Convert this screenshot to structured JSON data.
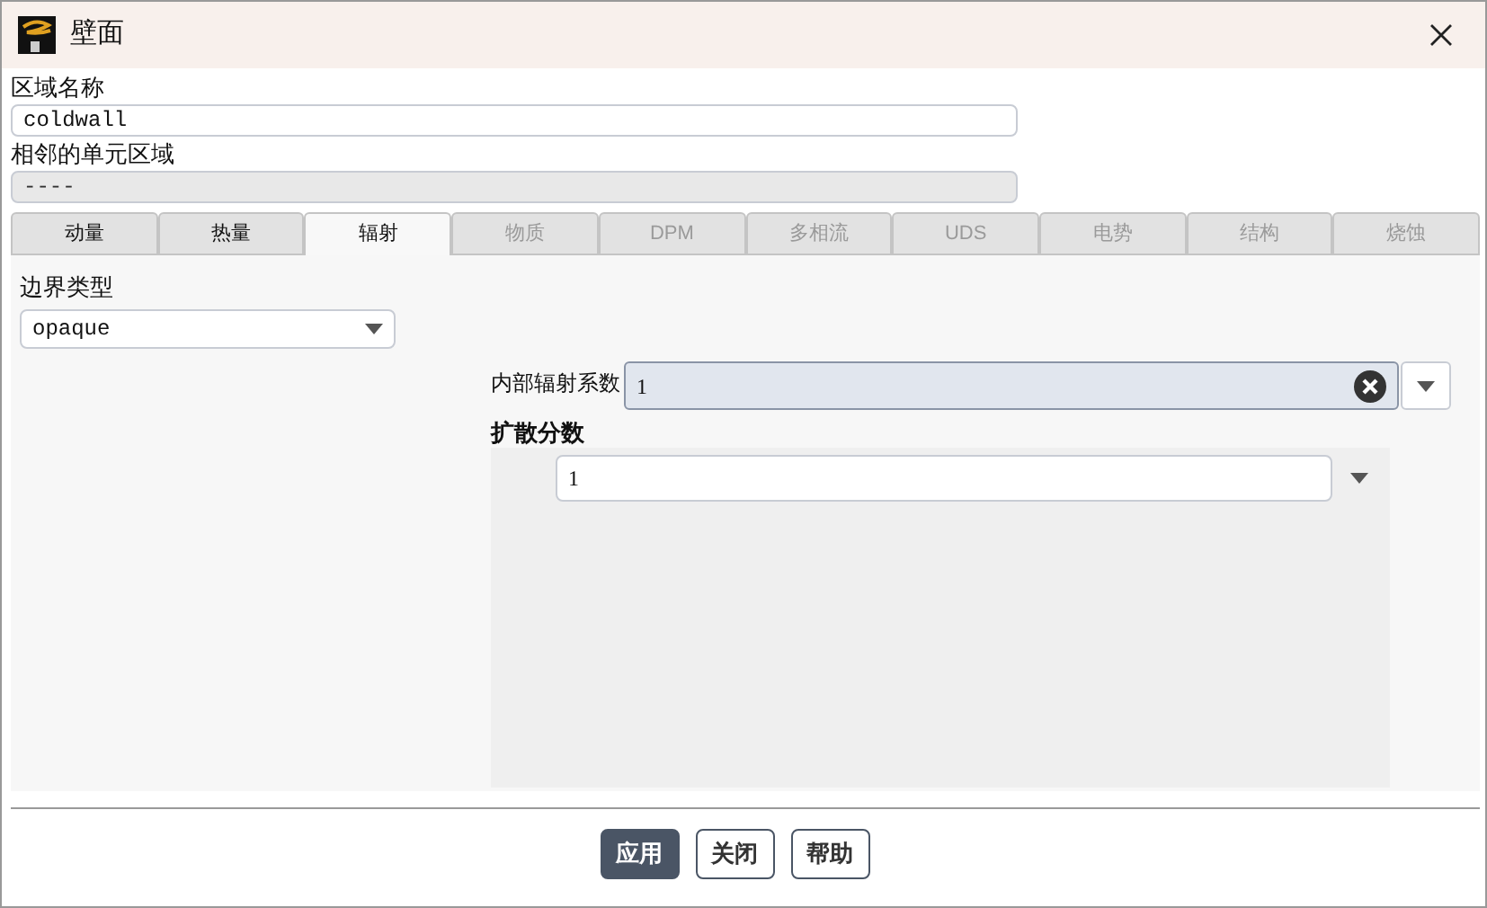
{
  "window": {
    "title": "壁面"
  },
  "zone_name": {
    "label": "区域名称",
    "value": "coldwall"
  },
  "adjacent_zone": {
    "label": "相邻的单元区域",
    "value": "----"
  },
  "tabs": [
    {
      "label": "动量",
      "selected": false,
      "disabled": false
    },
    {
      "label": "热量",
      "selected": false,
      "disabled": false
    },
    {
      "label": "辐射",
      "selected": true,
      "disabled": false
    },
    {
      "label": "物质",
      "selected": false,
      "disabled": true
    },
    {
      "label": "DPM",
      "selected": false,
      "disabled": true
    },
    {
      "label": "多相流",
      "selected": false,
      "disabled": true
    },
    {
      "label": "UDS",
      "selected": false,
      "disabled": true
    },
    {
      "label": "电势",
      "selected": false,
      "disabled": true
    },
    {
      "label": "结构",
      "selected": false,
      "disabled": true
    },
    {
      "label": "烧蚀",
      "selected": false,
      "disabled": true
    }
  ],
  "boundary_type": {
    "label": "边界类型",
    "value": "opaque"
  },
  "internal_emissivity": {
    "label": "内部辐射系数",
    "value": "1"
  },
  "diffuse_fraction": {
    "label": "扩散分数",
    "value": "1"
  },
  "buttons": [
    {
      "label": "应用",
      "primary": true
    },
    {
      "label": "关闭",
      "primary": false
    },
    {
      "label": "帮助",
      "primary": false
    }
  ]
}
